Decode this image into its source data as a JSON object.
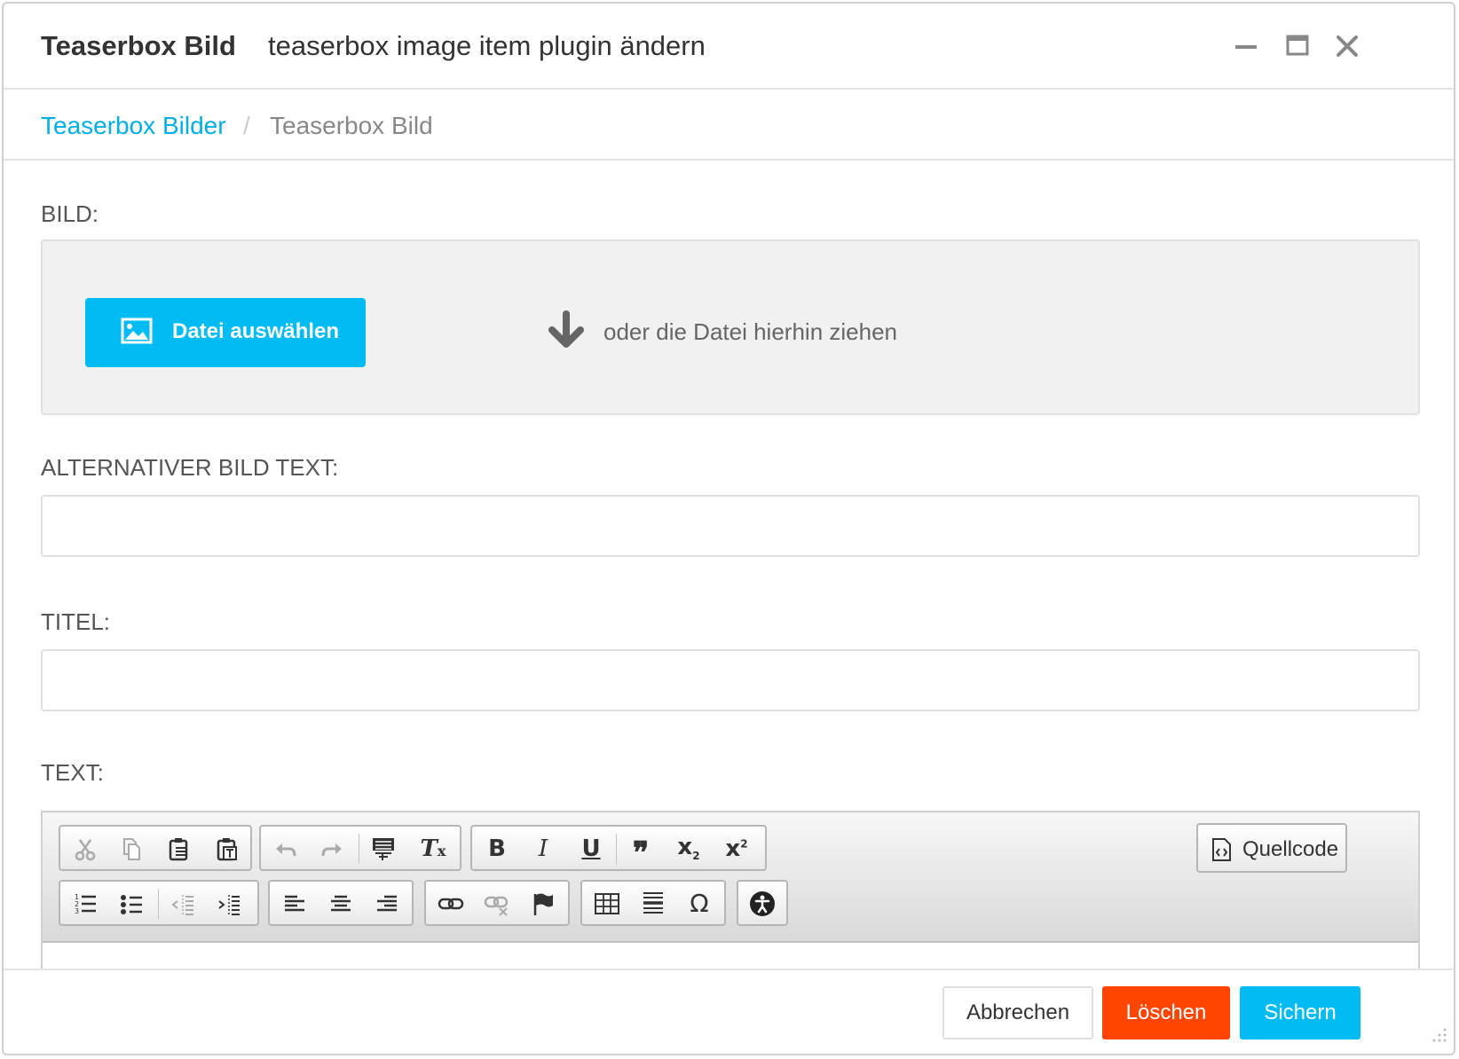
{
  "window": {
    "title": "Teaserbox Bild",
    "subtitle": "teaserbox image item plugin ändern",
    "controls": [
      "minimize-icon",
      "maximize-icon",
      "close-icon"
    ]
  },
  "breadcrumb": {
    "parent": "Teaserbox Bilder",
    "separator": "/",
    "current": "Teaserbox Bild"
  },
  "form": {
    "image_label": "BILD:",
    "file_button_label": "Datei auswählen",
    "drop_text": "oder die Datei hierhin ziehen",
    "alt_label": "ALTERNATIVER BILD TEXT:",
    "alt_value": "",
    "title_label": "TITEL:",
    "title_value": "",
    "text_label": "TEXT:"
  },
  "editor": {
    "source_label": "Quellcode",
    "toolbar_row1": [
      "cut-icon",
      "copy-icon",
      "paste-icon",
      "paste-text-icon",
      "undo-icon",
      "redo-icon",
      "paste-word-icon",
      "remove-format-icon",
      "bold-icon",
      "italic-icon",
      "underline-icon",
      "blockquote-icon",
      "subscript-icon",
      "superscript-icon"
    ],
    "toolbar_row2": [
      "numbered-list-icon",
      "bulleted-list-icon",
      "outdent-icon",
      "indent-icon",
      "align-left-icon",
      "align-center-icon",
      "align-right-icon",
      "link-icon",
      "unlink-icon",
      "anchor-icon",
      "table-icon",
      "horizontal-line-icon",
      "special-char-icon",
      "accessibility-icon"
    ]
  },
  "footer": {
    "cancel_label": "Abbrechen",
    "delete_label": "Löschen",
    "save_label": "Sichern"
  },
  "colors": {
    "accent": "#00bcf2",
    "link": "#00aee6",
    "danger": "#ff4500"
  }
}
